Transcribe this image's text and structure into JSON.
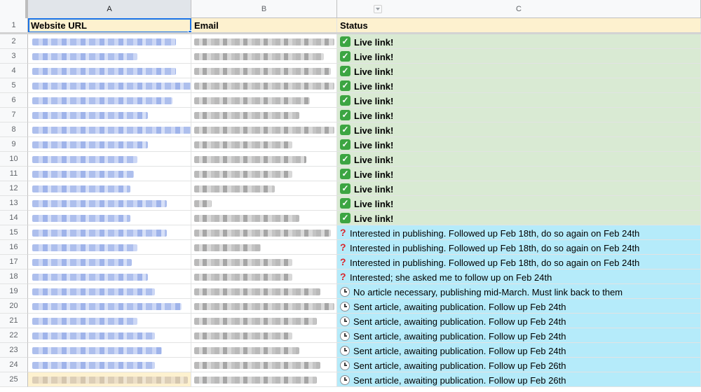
{
  "columns": {
    "a": "A",
    "b": "B",
    "c": "C"
  },
  "header": {
    "row_number": "1",
    "url": "Website URL",
    "email": "Email",
    "status": "Status"
  },
  "rows": [
    {
      "n": "2",
      "status": "Live link!",
      "kind": "live"
    },
    {
      "n": "3",
      "status": "Live link!",
      "kind": "live"
    },
    {
      "n": "4",
      "status": "Live link!",
      "kind": "live"
    },
    {
      "n": "5",
      "status": "Live link!",
      "kind": "live"
    },
    {
      "n": "6",
      "status": "Live link!",
      "kind": "live"
    },
    {
      "n": "7",
      "status": "Live link!",
      "kind": "live"
    },
    {
      "n": "8",
      "status": "Live link!",
      "kind": "live"
    },
    {
      "n": "9",
      "status": "Live link!",
      "kind": "live"
    },
    {
      "n": "10",
      "status": "Live link!",
      "kind": "live"
    },
    {
      "n": "11",
      "status": "Live link!",
      "kind": "live"
    },
    {
      "n": "12",
      "status": "Live link!",
      "kind": "live"
    },
    {
      "n": "13",
      "status": "Live link!",
      "kind": "live"
    },
    {
      "n": "14",
      "status": "Live link!",
      "kind": "live"
    },
    {
      "n": "15",
      "status": "Interested in publishing. Followed up Feb 18th, do so again on Feb 24th",
      "kind": "interest"
    },
    {
      "n": "16",
      "status": "Interested in publishing. Followed up Feb 18th, do so again on Feb 24th",
      "kind": "interest"
    },
    {
      "n": "17",
      "status": "Interested in publishing. Followed up Feb 18th, do so again on Feb 24th",
      "kind": "interest"
    },
    {
      "n": "18",
      "status": "Interested; she asked me to follow up on Feb 24th",
      "kind": "interest"
    },
    {
      "n": "19",
      "status": "No article necessary, publishing mid-March. Must link back to them",
      "kind": "waiting"
    },
    {
      "n": "20",
      "status": "Sent article, awaiting publication. Follow up Feb 24th",
      "kind": "waiting"
    },
    {
      "n": "21",
      "status": "Sent article, awaiting publication. Follow up Feb 24th",
      "kind": "waiting"
    },
    {
      "n": "22",
      "status": "Sent article, awaiting publication. Follow up Feb 24th",
      "kind": "waiting"
    },
    {
      "n": "23",
      "status": "Sent article, awaiting publication. Follow up Feb 24th",
      "kind": "waiting"
    },
    {
      "n": "24",
      "status": "Sent article, awaiting publication. Follow up Feb 26th",
      "kind": "waiting"
    },
    {
      "n": "25",
      "status": "Sent article, awaiting publication. Follow up Feb 26th",
      "kind": "waiting"
    }
  ],
  "icons": {
    "live": "check-mark-icon",
    "interest": "question-mark-icon",
    "waiting": "clock-icon"
  },
  "colors": {
    "live_bg": "#d9ead3",
    "pending_bg": "#b5ebfa",
    "header_bg": "#fdf1cf",
    "selection": "#1a73e8"
  }
}
